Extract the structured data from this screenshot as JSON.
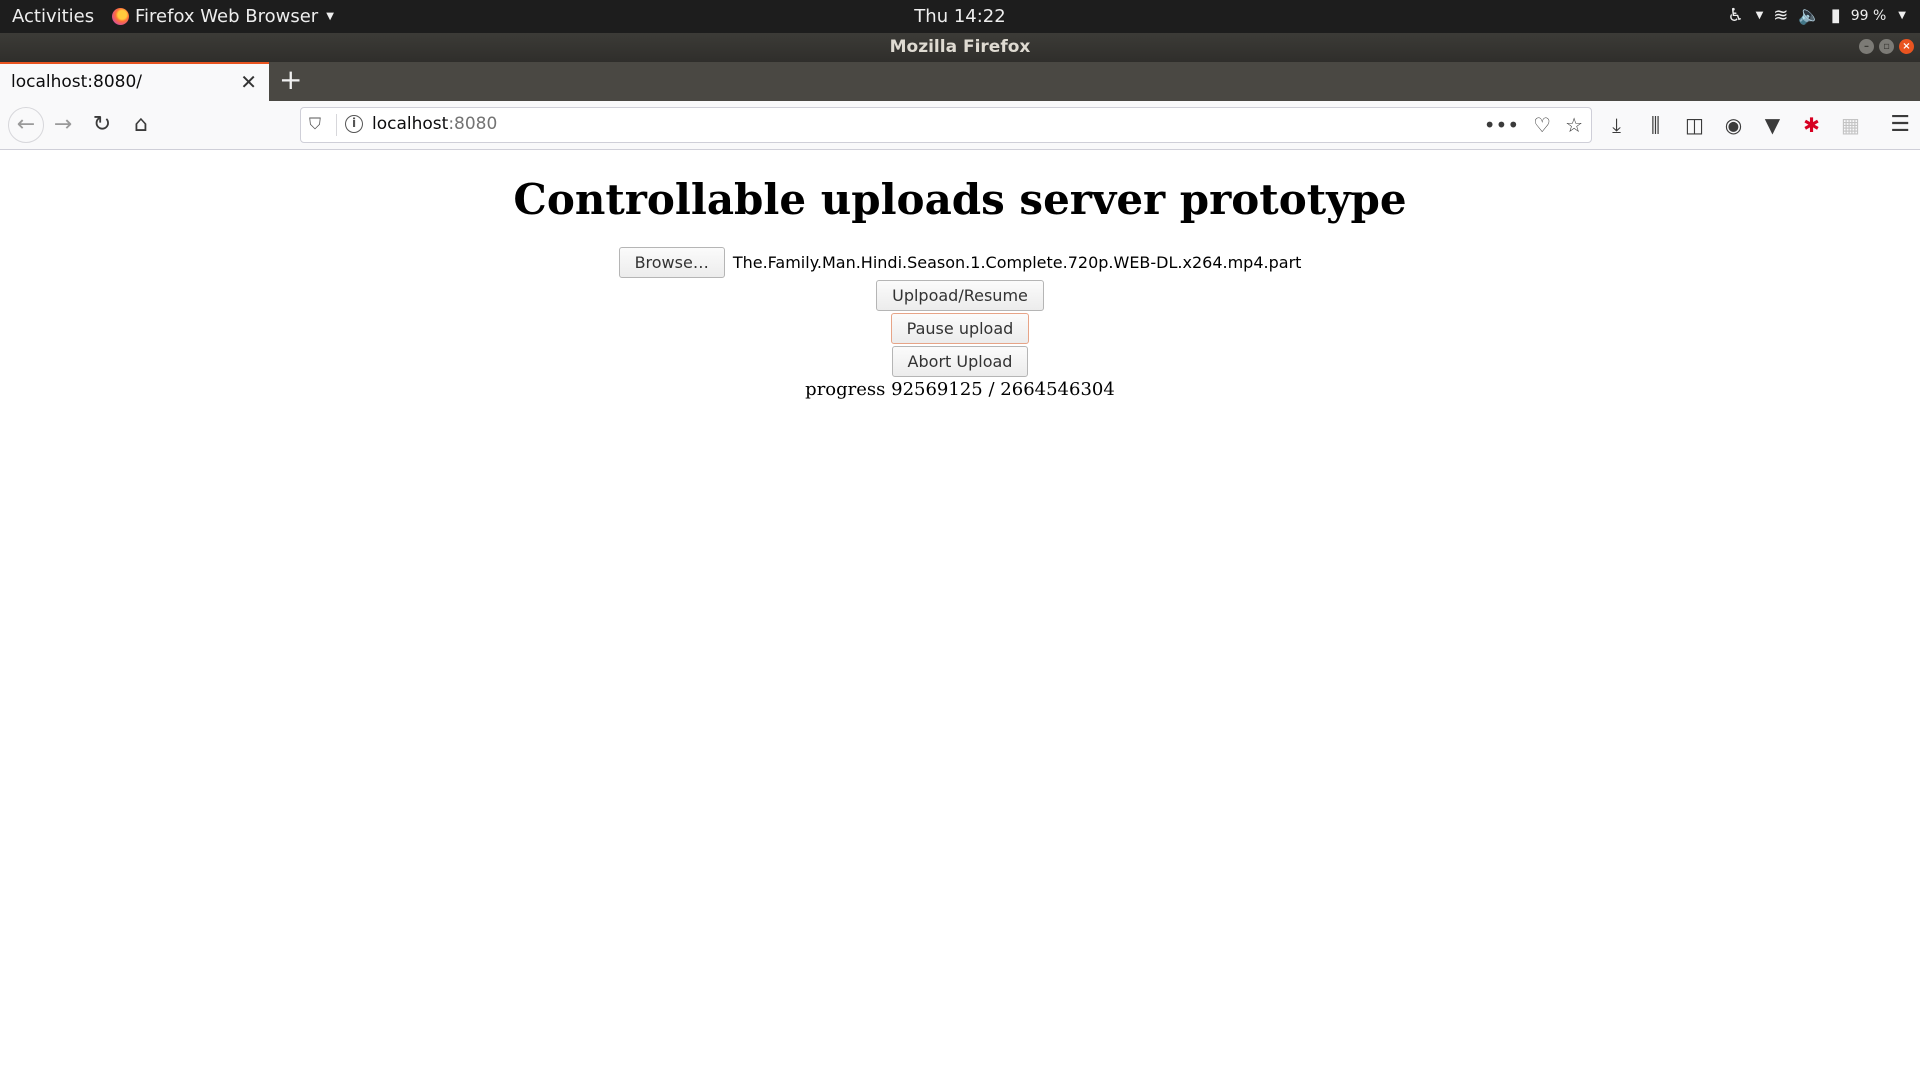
{
  "system_bar": {
    "activities": "Activities",
    "app_name": "Firefox Web Browser",
    "clock": "Thu 14:22",
    "battery": "99 %"
  },
  "window": {
    "title": "Mozilla Firefox"
  },
  "tabs": [
    {
      "label": "localhost:8080/"
    }
  ],
  "navbar": {
    "url_host": "localhost",
    "url_port": ":8080"
  },
  "page": {
    "heading": "Controllable uploads server prototype",
    "browse_label": "Browse…",
    "selected_file": "The.Family.Man.Hindi.Season.1.Complete.720p.WEB-DL.x264.mp4.part",
    "upload_label": "Uplpoad/Resume",
    "pause_label": "Pause upload",
    "abort_label": "Abort Upload",
    "progress_label": "progress",
    "progress_current": "92569125",
    "progress_sep": "/",
    "progress_total": "2664546304"
  },
  "colors": {
    "accent": "#e95420",
    "topbar_bg": "#1d1d1d",
    "titlebar_bg": "#3c3b37"
  }
}
